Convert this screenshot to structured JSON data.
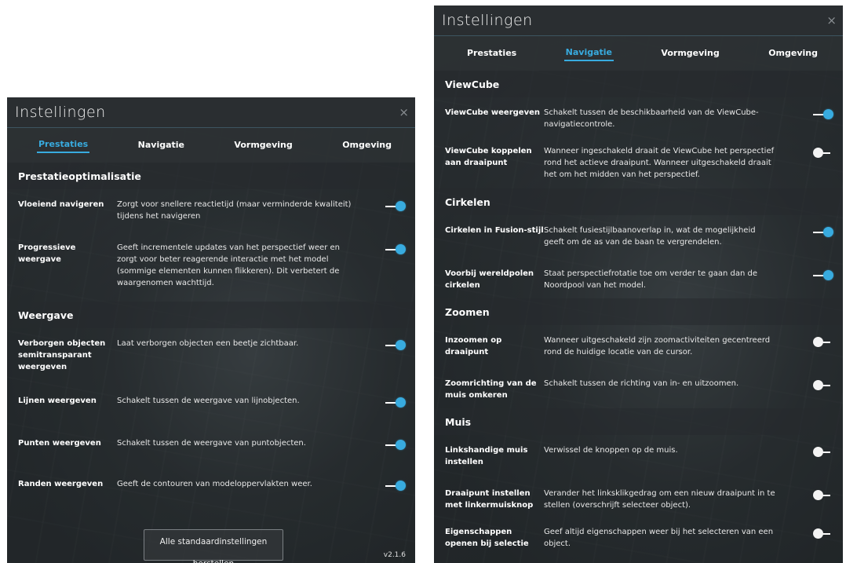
{
  "left": {
    "title": "Instellingen",
    "close": "×",
    "tabs": [
      "Prestaties",
      "Navigatie",
      "Vormgeving",
      "Omgeving"
    ],
    "sections": [
      {
        "title": "Prestatieoptimalisatie",
        "items": [
          {
            "label": "Vloeiend navigeren",
            "desc": "Zorgt voor snellere reactietijd (maar verminderde kwaliteit) tijdens het navigeren",
            "on": true
          },
          {
            "label": "Progressieve weergave",
            "desc": "Geeft incrementele updates van het perspectief weer en zorgt voor beter reagerende interactie met het model (sommige elementen kunnen flikkeren). Dit verbetert de waargenomen wachttijd.",
            "on": true
          }
        ]
      },
      {
        "title": "Weergave",
        "items": [
          {
            "label": "Verborgen objecten semitransparant weergeven",
            "desc": "Laat verborgen objecten een beetje zichtbaar.",
            "on": true
          },
          {
            "label": "Lijnen weergeven",
            "desc": "Schakelt tussen de weergave van lijnobjecten.",
            "on": true
          },
          {
            "label": "Punten weergeven",
            "desc": "Schakelt tussen de weergave van puntobjecten.",
            "on": true
          },
          {
            "label": "Randen weergeven",
            "desc": "Geeft de contouren van modeloppervlakten weer.",
            "on": true
          }
        ]
      }
    ],
    "reset_line1": "Alle standaardinstellingen",
    "reset_line2": "herstellen",
    "version": "v2.1.6"
  },
  "right": {
    "title": "Instellingen",
    "close": "×",
    "tabs": [
      "Prestaties",
      "Navigatie",
      "Vormgeving",
      "Omgeving"
    ],
    "sections": [
      {
        "title": "ViewCube",
        "items": [
          {
            "label": "ViewCube weergeven",
            "desc": "Schakelt tussen de beschikbaarheid van de ViewCube-navigatiecontrole.",
            "on": true
          },
          {
            "label": "ViewCube koppelen aan draaipunt",
            "desc": "Wanneer ingeschakeld draait de ViewCube het perspectief rond het actieve draaipunt. Wanneer uitgeschakeld draait het om het midden van het perspectief.",
            "on": false
          }
        ]
      },
      {
        "title": "Cirkelen",
        "items": [
          {
            "label": "Cirkelen in Fusion-stijl",
            "desc": "Schakelt fusiestijlbaanoverlap in, wat de mogelijkheid geeft om de as van de baan te vergrendelen.",
            "on": true
          },
          {
            "label": "Voorbij wereldpolen cirkelen",
            "desc": "Staat perspectiefrotatie toe om verder te gaan dan de Noordpool van het model.",
            "on": true
          }
        ]
      },
      {
        "title": "Zoomen",
        "items": [
          {
            "label": "Inzoomen op draaipunt",
            "desc": "Wanneer uitgeschakeld zijn zoomactiviteiten gecentreerd rond de huidige locatie van de cursor.",
            "on": false
          },
          {
            "label": "Zoomrichting van de muis omkeren",
            "desc": "Schakelt tussen de richting van in- en uitzoomen.",
            "on": false
          }
        ]
      },
      {
        "title": "Muis",
        "items": [
          {
            "label": "Linkshandige muis instellen",
            "desc": "Verwissel de knoppen op de muis.",
            "on": false
          },
          {
            "label": "Draaipunt instellen met linkermuisknop",
            "desc": "Verander het linksklikgedrag om een nieuw draaipunt in te stellen (overschrijft selecteer object).",
            "on": false
          },
          {
            "label": "Eigenschappen openen bij selectie",
            "desc": "Geef altijd eigenschappen weer bij het selecteren van een object.",
            "on": false
          }
        ]
      }
    ]
  },
  "colors": {
    "accent": "#38abdf",
    "panel_bg": "#2c3034"
  }
}
